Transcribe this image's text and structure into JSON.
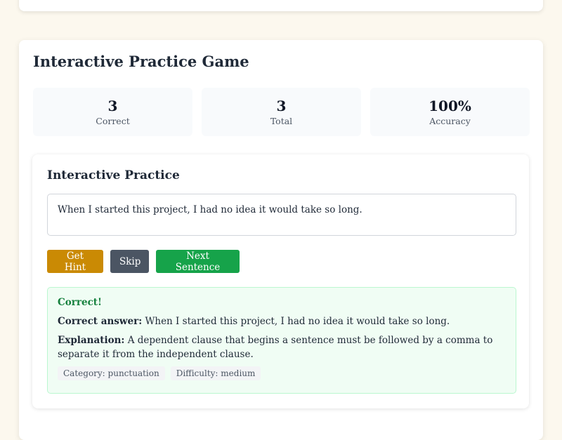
{
  "game": {
    "title": "Interactive Practice Game",
    "stats": [
      {
        "value": "3",
        "label": "Correct"
      },
      {
        "value": "3",
        "label": "Total"
      },
      {
        "value": "100%",
        "label": "Accuracy"
      }
    ]
  },
  "practice": {
    "title": "Interactive Practice",
    "sentence": "When I started this project, I had no idea it would take so long.",
    "buttons": {
      "hint": "Get Hint",
      "skip": "Skip",
      "next": "Next Sentence"
    },
    "feedback": {
      "status": "Correct!",
      "answer_label": "Correct answer:",
      "answer_text": "When I started this project, I had no idea it would take so long.",
      "explanation_label": "Explanation:",
      "explanation_text": "A dependent clause that begins a sentence must be followed by a comma to separate it from the independent clause.",
      "category": "Category: punctuation",
      "difficulty": "Difficulty: medium"
    }
  },
  "colors": {
    "hint": "#ca8a04",
    "skip": "#4b5563",
    "next": "#16a34a",
    "success": "#15803d"
  }
}
